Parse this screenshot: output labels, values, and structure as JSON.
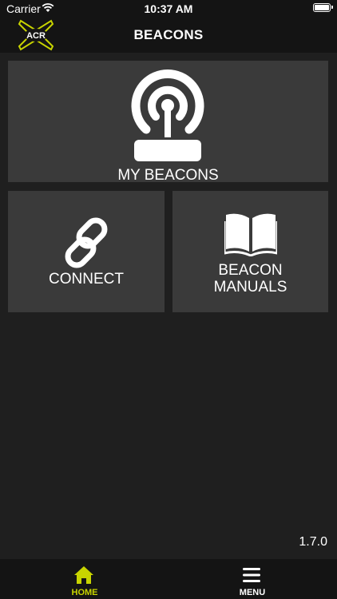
{
  "status_bar": {
    "carrier": "Carrier",
    "time": "10:37 AM"
  },
  "header": {
    "logo_text": "ACR",
    "title": "BEACONS"
  },
  "tiles": {
    "my_beacons": {
      "label": "MY BEACONS",
      "icon": "beacon-signal-icon"
    },
    "connect": {
      "label": "CONNECT",
      "icon": "link-icon"
    },
    "manuals": {
      "label_line1": "BEACON",
      "label_line2": "MANUALS",
      "icon": "book-icon"
    }
  },
  "version": "1.7.0",
  "tab_bar": {
    "home": {
      "label": "HOME",
      "icon": "home-icon",
      "active": true
    },
    "menu": {
      "label": "MENU",
      "icon": "hamburger-menu-icon"
    }
  },
  "colors": {
    "accent": "#c8d400",
    "tile": "#3a3a3a",
    "background": "#1f1f1f",
    "bar": "#141414"
  }
}
